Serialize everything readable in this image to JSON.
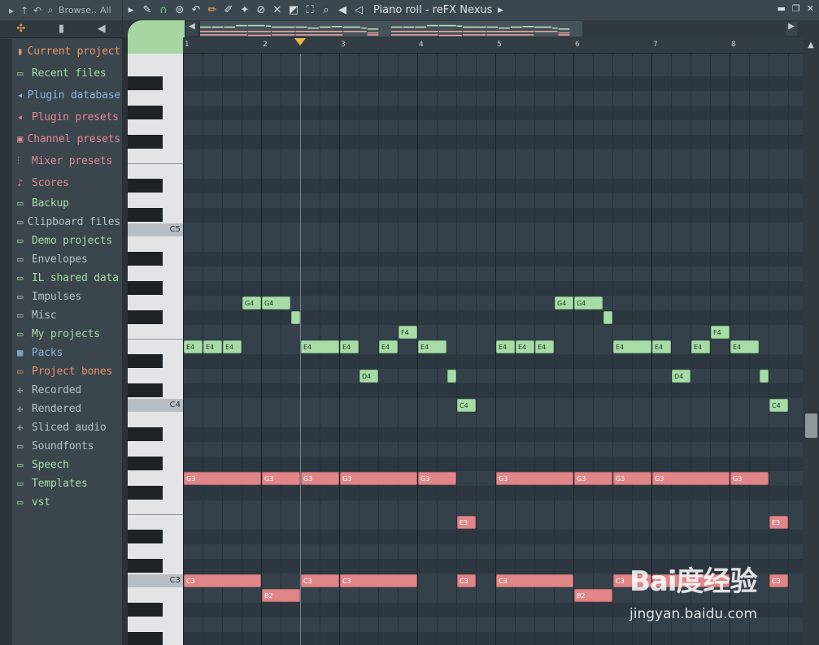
{
  "browser": {
    "toolbar": {
      "label": "Browse..",
      "filter": "All"
    },
    "items": [
      {
        "label": "Current project",
        "icon": "project-icon",
        "color": "#e8946a"
      },
      {
        "label": "Recent files",
        "icon": "folder-icon",
        "color": "#a8dca6"
      },
      {
        "label": "Plugin database",
        "icon": "plugin-icon",
        "color": "#8fb6e0"
      },
      {
        "label": "Plugin presets",
        "icon": "plugin-icon",
        "color": "#e0889a"
      },
      {
        "label": "Channel presets",
        "icon": "channel-icon",
        "color": "#e0889a"
      },
      {
        "label": "Mixer presets",
        "icon": "mixer-icon",
        "color": "#e0889a"
      },
      {
        "label": "Scores",
        "icon": "note-icon",
        "color": "#e0889a"
      },
      {
        "label": "Backup",
        "icon": "folder-icon",
        "color": "#a8dca6"
      },
      {
        "label": "Clipboard files",
        "icon": "folder-icon",
        "color": "#b9c2c7"
      },
      {
        "label": "Demo projects",
        "icon": "folder-icon",
        "color": "#a8dca6"
      },
      {
        "label": "Envelopes",
        "icon": "folder-icon",
        "color": "#b9c2c7"
      },
      {
        "label": "IL shared data",
        "icon": "folder-icon",
        "color": "#a8dca6"
      },
      {
        "label": "Impulses",
        "icon": "folder-icon",
        "color": "#b9c2c7"
      },
      {
        "label": "Misc",
        "icon": "folder-icon",
        "color": "#b9c2c7"
      },
      {
        "label": "My projects",
        "icon": "folder-icon",
        "color": "#a8dca6"
      },
      {
        "label": "Packs",
        "icon": "packs-icon",
        "color": "#8fb6e0"
      },
      {
        "label": "Project bones",
        "icon": "folder-icon",
        "color": "#e8946a"
      },
      {
        "label": "Recorded",
        "icon": "audio-icon",
        "color": "#b9c2c7"
      },
      {
        "label": "Rendered",
        "icon": "audio-icon",
        "color": "#b9c2c7"
      },
      {
        "label": "Sliced audio",
        "icon": "audio-icon",
        "color": "#b9c2c7"
      },
      {
        "label": "Soundfonts",
        "icon": "folder-icon",
        "color": "#b9c2c7"
      },
      {
        "label": "Speech",
        "icon": "folder-icon",
        "color": "#a8dca6"
      },
      {
        "label": "Templates",
        "icon": "folder-icon",
        "color": "#a8dca6"
      },
      {
        "label": "vst",
        "icon": "folder-icon",
        "color": "#a8dca6"
      }
    ]
  },
  "piano_roll": {
    "title": "Piano roll - reFX Nexus",
    "bars": [
      "1",
      "2",
      "3",
      "4",
      "5",
      "6",
      "7",
      "8"
    ],
    "octave_labels": [
      "C5",
      "C4",
      "C3"
    ],
    "playhead_bar": 2.5,
    "notes": [
      {
        "label": "G4",
        "pitch": "G4",
        "start": 0.75,
        "length": 0.25,
        "color": "green"
      },
      {
        "label": "G4",
        "pitch": "G4",
        "start": 1.0,
        "length": 0.375,
        "color": "green"
      },
      {
        "label": "",
        "pitch": "F#4",
        "start": 1.375,
        "length": 0.125,
        "color": "green"
      },
      {
        "label": "E4",
        "pitch": "E4",
        "start": 0.0,
        "length": 0.25,
        "color": "green"
      },
      {
        "label": "E4",
        "pitch": "E4",
        "start": 0.25,
        "length": 0.25,
        "color": "green"
      },
      {
        "label": "E4",
        "pitch": "E4",
        "start": 0.5,
        "length": 0.25,
        "color": "green"
      },
      {
        "label": "E4",
        "pitch": "E4",
        "start": 1.5,
        "length": 0.5,
        "color": "green"
      },
      {
        "label": "E4",
        "pitch": "E4",
        "start": 2.0,
        "length": 0.25,
        "color": "green"
      },
      {
        "label": "D4",
        "pitch": "D4",
        "start": 2.25,
        "length": 0.25,
        "color": "green"
      },
      {
        "label": "E4",
        "pitch": "E4",
        "start": 2.5,
        "length": 0.25,
        "color": "green"
      },
      {
        "label": "F4",
        "pitch": "F4",
        "start": 2.75,
        "length": 0.25,
        "color": "green"
      },
      {
        "label": "E4",
        "pitch": "E4",
        "start": 3.0,
        "length": 0.375,
        "color": "green"
      },
      {
        "label": "",
        "pitch": "D4",
        "start": 3.375,
        "length": 0.125,
        "color": "green"
      },
      {
        "label": "C4",
        "pitch": "C4",
        "start": 3.5,
        "length": 0.25,
        "color": "green"
      },
      {
        "label": "E4",
        "pitch": "E4",
        "start": 4.0,
        "length": 0.25,
        "color": "green"
      },
      {
        "label": "E4",
        "pitch": "E4",
        "start": 4.25,
        "length": 0.25,
        "color": "green"
      },
      {
        "label": "E4",
        "pitch": "E4",
        "start": 4.5,
        "length": 0.25,
        "color": "green"
      },
      {
        "label": "G4",
        "pitch": "G4",
        "start": 4.75,
        "length": 0.25,
        "color": "green"
      },
      {
        "label": "G4",
        "pitch": "G4",
        "start": 5.0,
        "length": 0.375,
        "color": "green"
      },
      {
        "label": "",
        "pitch": "F#4",
        "start": 5.375,
        "length": 0.125,
        "color": "green"
      },
      {
        "label": "E4",
        "pitch": "E4",
        "start": 5.5,
        "length": 0.5,
        "color": "green"
      },
      {
        "label": "E4",
        "pitch": "E4",
        "start": 6.0,
        "length": 0.25,
        "color": "green"
      },
      {
        "label": "D4",
        "pitch": "D4",
        "start": 6.25,
        "length": 0.25,
        "color": "green"
      },
      {
        "label": "E4",
        "pitch": "E4",
        "start": 6.5,
        "length": 0.25,
        "color": "green"
      },
      {
        "label": "F4",
        "pitch": "F4",
        "start": 6.75,
        "length": 0.25,
        "color": "green"
      },
      {
        "label": "E4",
        "pitch": "E4",
        "start": 7.0,
        "length": 0.375,
        "color": "green"
      },
      {
        "label": "",
        "pitch": "D4",
        "start": 7.375,
        "length": 0.125,
        "color": "green"
      },
      {
        "label": "C4",
        "pitch": "C4",
        "start": 7.5,
        "length": 0.25,
        "color": "green"
      },
      {
        "label": "G3",
        "pitch": "G3",
        "start": 0.0,
        "length": 1.0,
        "color": "red"
      },
      {
        "label": "G3",
        "pitch": "G3",
        "start": 1.0,
        "length": 0.5,
        "color": "red"
      },
      {
        "label": "G3",
        "pitch": "G3",
        "start": 1.5,
        "length": 0.5,
        "color": "red"
      },
      {
        "label": "G3",
        "pitch": "G3",
        "start": 2.0,
        "length": 1.0,
        "color": "red"
      },
      {
        "label": "G3",
        "pitch": "G3",
        "start": 3.0,
        "length": 0.5,
        "color": "red"
      },
      {
        "label": "G3",
        "pitch": "G3",
        "start": 4.0,
        "length": 1.0,
        "color": "red"
      },
      {
        "label": "G3",
        "pitch": "G3",
        "start": 5.0,
        "length": 0.5,
        "color": "red"
      },
      {
        "label": "G3",
        "pitch": "G3",
        "start": 5.5,
        "length": 0.5,
        "color": "red"
      },
      {
        "label": "G3",
        "pitch": "G3",
        "start": 6.0,
        "length": 1.0,
        "color": "red"
      },
      {
        "label": "G3",
        "pitch": "G3",
        "start": 7.0,
        "length": 0.5,
        "color": "red"
      },
      {
        "label": "E3",
        "pitch": "E3",
        "start": 3.5,
        "length": 0.25,
        "color": "red"
      },
      {
        "label": "E3",
        "pitch": "E3",
        "start": 7.5,
        "length": 0.25,
        "color": "red"
      },
      {
        "label": "C3",
        "pitch": "C3",
        "start": 0.0,
        "length": 1.0,
        "color": "red"
      },
      {
        "label": "B2",
        "pitch": "B2",
        "start": 1.0,
        "length": 0.5,
        "color": "red"
      },
      {
        "label": "C3",
        "pitch": "C3",
        "start": 1.5,
        "length": 0.5,
        "color": "red"
      },
      {
        "label": "C3",
        "pitch": "C3",
        "start": 2.0,
        "length": 1.0,
        "color": "red"
      },
      {
        "label": "C3",
        "pitch": "C3",
        "start": 3.5,
        "length": 0.25,
        "color": "red"
      },
      {
        "label": "C3",
        "pitch": "C3",
        "start": 4.0,
        "length": 1.0,
        "color": "red"
      },
      {
        "label": "B2",
        "pitch": "B2",
        "start": 5.0,
        "length": 0.5,
        "color": "red"
      },
      {
        "label": "C3",
        "pitch": "C3",
        "start": 5.5,
        "length": 0.5,
        "color": "red"
      },
      {
        "label": "C3",
        "pitch": "C3",
        "start": 6.0,
        "length": 1.0,
        "color": "red"
      },
      {
        "label": "C3",
        "pitch": "C3",
        "start": 7.5,
        "length": 0.25,
        "color": "red"
      }
    ]
  },
  "watermark": {
    "brand": "Bai度经验",
    "url": "jingyan.baidu.com"
  }
}
